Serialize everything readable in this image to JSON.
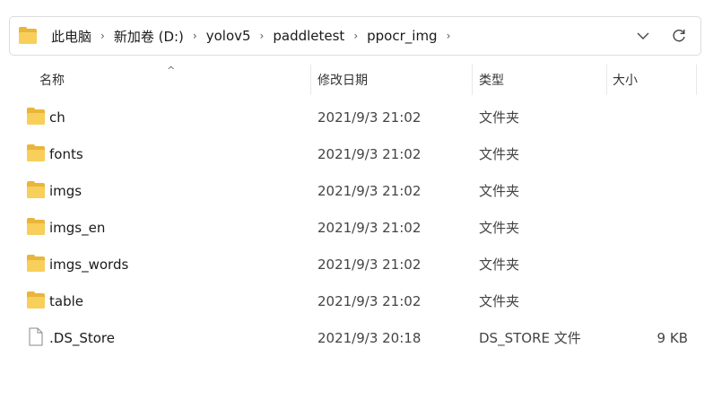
{
  "address_bar": {
    "folder_icon": "folder-icon",
    "crumbs": [
      "此电脑",
      "新加卷 (D:)",
      "yolov5",
      "paddletest",
      "ppocr_img"
    ],
    "dropdown_icon": "chevron-down-icon",
    "refresh_icon": "refresh-icon"
  },
  "columns": {
    "name": "名称",
    "date": "修改日期",
    "type": "类型",
    "size": "大小",
    "sort_indicator": "^"
  },
  "files": [
    {
      "name": "ch",
      "date": "2021/9/3 21:02",
      "type": "文件夹",
      "size": "",
      "icon": "folder-icon"
    },
    {
      "name": "fonts",
      "date": "2021/9/3 21:02",
      "type": "文件夹",
      "size": "",
      "icon": "folder-icon"
    },
    {
      "name": "imgs",
      "date": "2021/9/3 21:02",
      "type": "文件夹",
      "size": "",
      "icon": "folder-icon"
    },
    {
      "name": "imgs_en",
      "date": "2021/9/3 21:02",
      "type": "文件夹",
      "size": "",
      "icon": "folder-icon"
    },
    {
      "name": "imgs_words",
      "date": "2021/9/3 21:02",
      "type": "文件夹",
      "size": "",
      "icon": "folder-icon"
    },
    {
      "name": "table",
      "date": "2021/9/3 21:02",
      "type": "文件夹",
      "size": "",
      "icon": "folder-icon"
    },
    {
      "name": ".DS_Store",
      "date": "2021/9/3 20:18",
      "type": "DS_STORE 文件",
      "size": "9 KB",
      "icon": "file-icon"
    }
  ]
}
